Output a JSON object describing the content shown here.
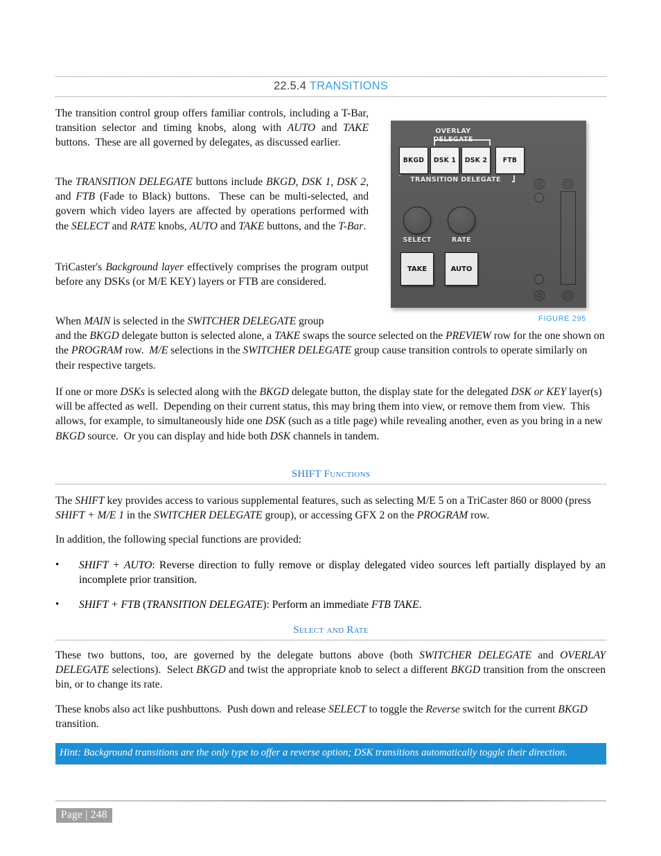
{
  "section": {
    "number": "22.5.4",
    "title": "TRANSITIONS",
    "accent_color": "#3a9fdc"
  },
  "paragraphs": {
    "p1": "The transition control group offers familiar controls, including a T-Bar, transition selector and timing knobs, along with AUTO and TAKE buttons.  These are all governed by delegates, as discussed earlier.",
    "p2": "The TRANSITION DELEGATE buttons include BKGD, DSK 1, DSK 2, and FTB (Fade to Black) buttons.  These can be multi-selected, and govern which video layers are affected by operations performed with the SELECT and RATE knobs, AUTO and TAKE buttons, and the T-Bar.",
    "p3": "TriCaster's Background layer effectively comprises the program output before any DSKs (or M/E KEY) layers or FTB are considered.",
    "p4": "When MAIN is selected in the SWITCHER DELEGATE group and the BKGD delegate button is selected alone, a TAKE swaps the source selected on the PREVIEW row for the one shown on the PROGRAM row.  M/E selections in the SWITCHER DELEGATE group cause transition controls to operate similarly on their respective targets.",
    "p5": "If one or more DSKs is selected along with the BKGD delegate button, the display state for the delegated DSK or KEY layer(s) will be affected as well.  Depending on their current status, this may bring them into view, or remove them from view.  This allows, for example, to simultaneously hide one DSK (such as a title page) while revealing another, even as you bring in a new BKGD source.  Or you can display and hide both DSK channels in tandem.",
    "p6": "The SHIFT key provides access to various supplemental features, such as selecting M/E 5 on a TriCaster 860 or 8000 (press SHIFT + M/E 1 in the SWITCHER DELEGATE group), or accessing GFX 2 on the PROGRAM row.",
    "p7": "In addition, the following special functions are provided:",
    "p8": "These two buttons, too, are governed by the delegate buttons above (both SWITCHER DELEGATE and OVERLAY DELEGATE selections).  Select BKGD and twist the appropriate knob to select a different BKGD transition from the onscreen bin, or to change its rate.",
    "p9": "These knobs also act like pushbuttons.  Push down and release SELECT to toggle the Reverse switch for the current BKGD transition."
  },
  "subheadings": {
    "shift": "SHIFT Functions",
    "select_rate": "Select and Rate"
  },
  "bullets": [
    {
      "marker": "•",
      "text": "SHIFT + AUTO: Reverse direction to fully remove or display delegated video sources left partially displayed by an incomplete prior transition."
    },
    {
      "marker": "•",
      "text": "SHIFT + FTB (TRANSITION DELEGATE): Perform an immediate FTB TAKE."
    }
  ],
  "hint": {
    "text": "Hint: Background transitions are the only type to offer a reverse option; DSK transitions automatically toggle their direction.",
    "background_color": "#1f8fd4",
    "text_color": "#ffffff"
  },
  "figure": {
    "caption": "FIGURE 295",
    "panel": {
      "background_color": "#585858",
      "overlay_label_line1": "OVERLAY",
      "overlay_label_line2": "DELEGATE",
      "transition_label": "TRANSITION DELEGATE",
      "delegate_buttons": [
        "BKGD",
        "DSK 1",
        "DSK 2",
        "FTB"
      ],
      "knobs": [
        {
          "label": "SELECT"
        },
        {
          "label": "RATE"
        }
      ],
      "action_buttons": [
        "TAKE",
        "AUTO"
      ],
      "tbar_present": true,
      "button_face_color": "#f4f4f4"
    }
  },
  "footer": {
    "page_label": "Page | 248",
    "badge_color": "#9e9e9e"
  }
}
